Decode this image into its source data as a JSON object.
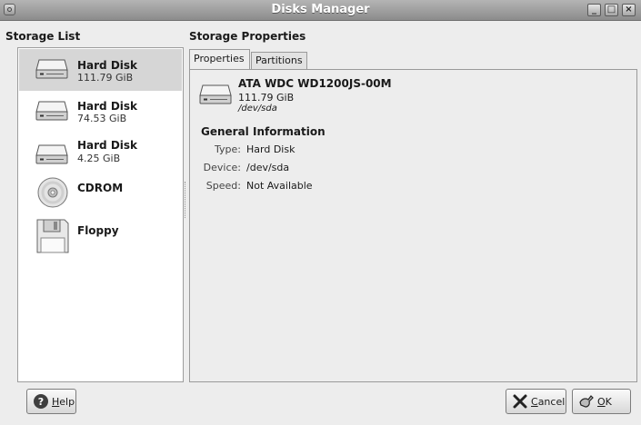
{
  "window": {
    "title": "Disks Manager",
    "controls": [
      "_",
      "□",
      "×"
    ]
  },
  "storage_list": {
    "title": "Storage List",
    "items": [
      {
        "name": "Hard Disk",
        "size": "111.79 GiB",
        "icon": "hard-disk-icon",
        "selected": true
      },
      {
        "name": "Hard Disk",
        "size": "74.53 GiB",
        "icon": "hard-disk-icon",
        "selected": false
      },
      {
        "name": "Hard Disk",
        "size": "4.25 GiB",
        "icon": "hard-disk-icon",
        "selected": false
      },
      {
        "name": "CDROM",
        "size": "",
        "icon": "cdrom-icon",
        "selected": false
      },
      {
        "name": "Floppy",
        "size": "",
        "icon": "floppy-icon",
        "selected": false
      }
    ]
  },
  "storage_properties": {
    "title": "Storage Properties",
    "tabs": [
      {
        "label": "Properties",
        "active": true
      },
      {
        "label": "Partitions",
        "active": false
      }
    ],
    "device": {
      "model": "ATA WDC WD1200JS-00M",
      "size": "111.79 GiB",
      "path": "/dev/sda",
      "icon": "hard-disk-icon"
    },
    "general_info": {
      "title": "General Information",
      "fields": [
        {
          "label": "Type:",
          "value": "Hard Disk"
        },
        {
          "label": "Device:",
          "value": "/dev/sda"
        },
        {
          "label": "Speed:",
          "value": "Not Available"
        }
      ]
    }
  },
  "buttons": {
    "help": {
      "underlined": "H",
      "rest": "elp",
      "icon": "help-icon"
    },
    "cancel": {
      "underlined": "C",
      "rest": "ancel",
      "icon": "cancel-icon"
    },
    "ok": {
      "underlined": "O",
      "rest": "K",
      "icon": "ok-icon"
    }
  }
}
